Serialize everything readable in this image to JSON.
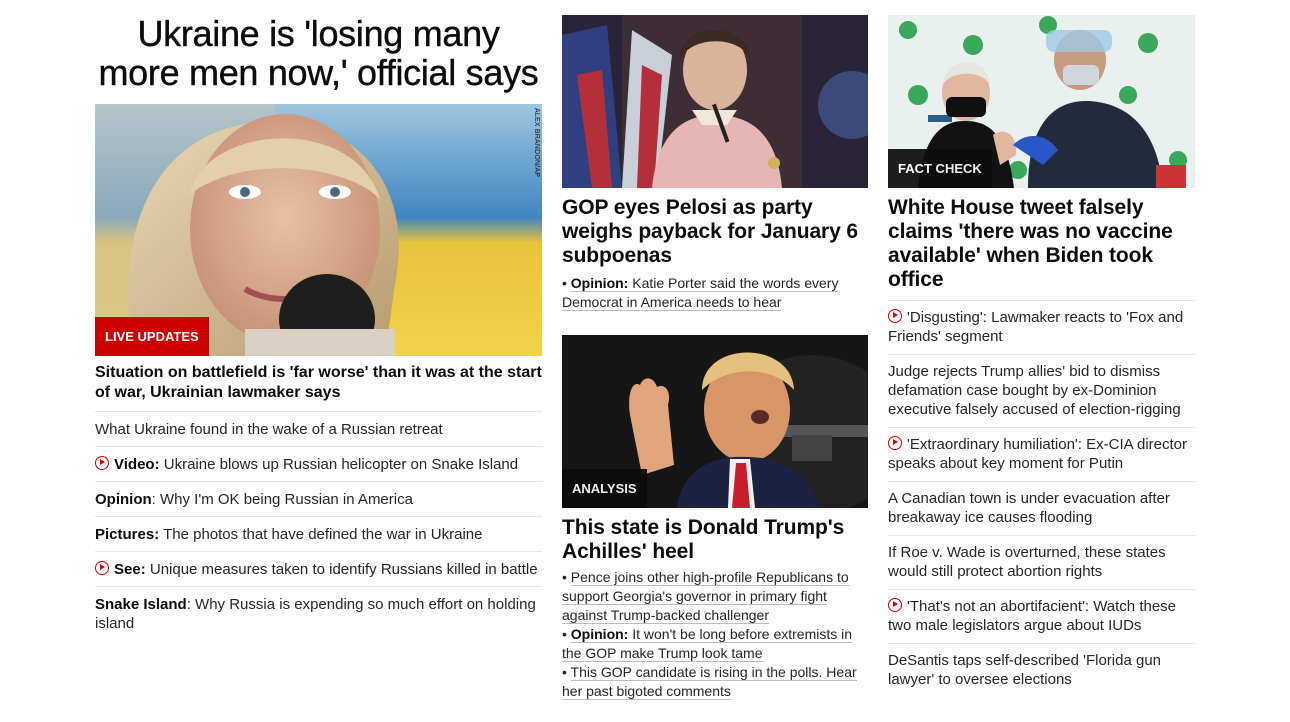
{
  "col1": {
    "title": "Ukraine is 'losing many more men now,' official says",
    "badge": "LIVE UPDATES",
    "photo_credit": "ALEX BRANDON/AP",
    "headline": "Situation on battlefield is 'far worse' than it was at the start of war, Ukrainian lawmaker says",
    "items": [
      {
        "prefix": "",
        "text": "What Ukraine found in the wake of a Russian retreat",
        "video": false
      },
      {
        "prefix": "Video:",
        "text": " Ukraine blows up Russian helicopter on Snake Island",
        "video": true
      },
      {
        "prefix": "Opinion",
        "text": ": Why I'm OK being Russian in America",
        "video": false
      },
      {
        "prefix": "Pictures:",
        "text": " The photos that have defined the war in Ukraine",
        "video": false
      },
      {
        "prefix": "See:",
        "text": " Unique measures taken to identify Russians killed in battle",
        "video": true
      },
      {
        "prefix": "Snake Island",
        "text": ": Why Russia is expending so much effort on holding island",
        "video": false
      }
    ]
  },
  "col2": {
    "story1": {
      "headline": "GOP eyes Pelosi as party weighs payback for January 6 subpoenas",
      "sub_prefix": "Opinion:",
      "sub_text": " Katie Porter said the words every Democrat in America needs to hear"
    },
    "story2": {
      "badge": "ANALYSIS",
      "headline": "This state is Donald Trump's Achilles' heel",
      "subs": [
        {
          "prefix": "",
          "text": "Pence joins other high-profile Republicans to support Georgia's governor in primary fight against Trump-backed challenger"
        },
        {
          "prefix": "Opinion:",
          "text": " It won't be long before extremists in the GOP make Trump look tame"
        },
        {
          "prefix": "",
          "text": "This GOP candidate is rising in the polls. Hear her past bigoted comments"
        }
      ]
    }
  },
  "col3": {
    "badge": "FACT CHECK",
    "headline": "White House tweet falsely claims 'there was no vaccine available' when Biden took office",
    "items": [
      {
        "text": "'Disgusting': Lawmaker reacts to 'Fox and Friends' segment",
        "video": true
      },
      {
        "text": "Judge rejects Trump allies' bid to dismiss defamation case bought by ex-Dominion executive falsely accused of election-rigging",
        "video": false
      },
      {
        "text": "'Extraordinary humiliation': Ex-CIA director speaks about key moment for Putin",
        "video": true
      },
      {
        "text": "A Canadian town is under evacuation after breakaway ice causes flooding",
        "video": false
      },
      {
        "text": "If Roe v. Wade is overturned, these states would still protect abortion rights",
        "video": false
      },
      {
        "text": "'That's not an abortifacient': Watch these two male legislators argue about IUDs",
        "video": true
      },
      {
        "text": "DeSantis taps self-described 'Florida gun lawyer' to oversee elections",
        "video": false
      }
    ]
  }
}
